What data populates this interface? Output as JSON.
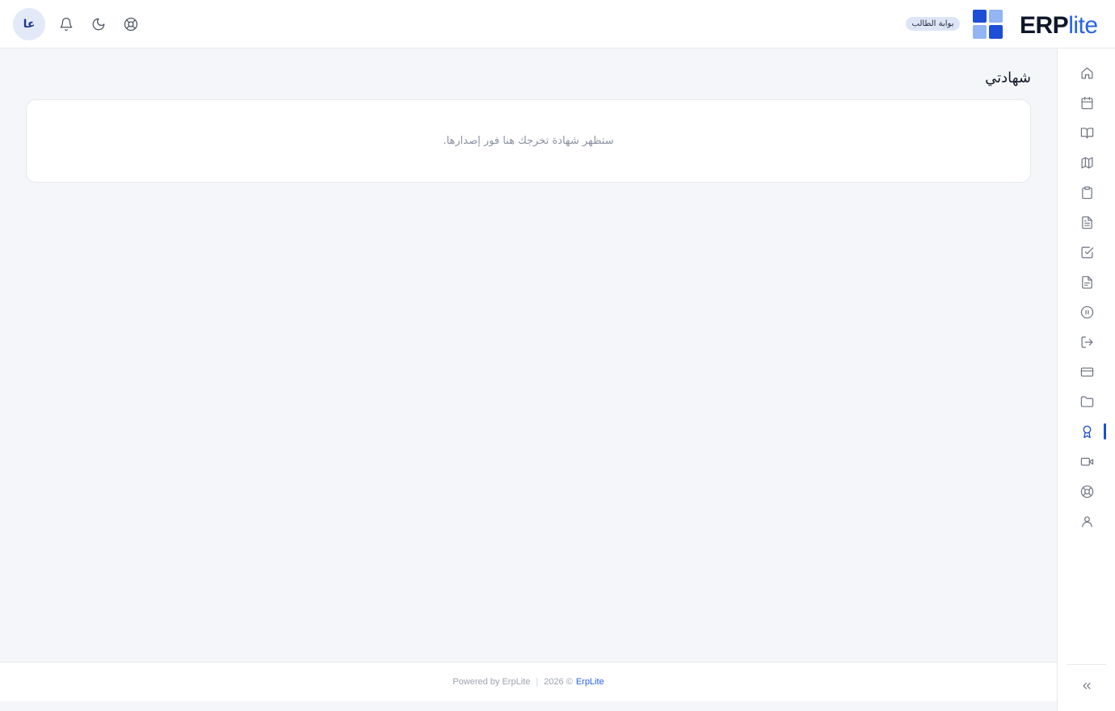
{
  "header": {
    "avatar_initials": "عا",
    "portal_badge": "بوابة الطالب",
    "logo": {
      "part1": "ERP",
      "part2": "lite"
    },
    "icons": [
      "support-icon",
      "moon-icon",
      "bell-icon"
    ]
  },
  "sidebar": {
    "items": [
      {
        "icon": "home-icon"
      },
      {
        "icon": "calendar-icon"
      },
      {
        "icon": "book-open-icon"
      },
      {
        "icon": "map-icon"
      },
      {
        "icon": "clipboard-icon"
      },
      {
        "icon": "file-text-icon"
      },
      {
        "icon": "check-square-icon"
      },
      {
        "icon": "file-lines-icon"
      },
      {
        "icon": "pause-circle-icon"
      },
      {
        "icon": "log-out-icon"
      },
      {
        "icon": "credit-card-icon"
      },
      {
        "icon": "folder-icon"
      },
      {
        "icon": "award-icon",
        "active": true
      },
      {
        "icon": "video-icon"
      },
      {
        "icon": "life-buoy-icon"
      },
      {
        "icon": "user-icon"
      }
    ],
    "collapse_icon": "chevrons-left-icon"
  },
  "main": {
    "page_title": "شهادتي",
    "empty_message": "ستظهر شهادة تخرجك هنا فور إصدارها."
  },
  "footer": {
    "powered": "Powered by ErpLite",
    "copyright": "2026 ©",
    "brand_link": "ErpLite"
  },
  "colors": {
    "accent": "#1d4ed8",
    "background": "#f4f6f9",
    "surface": "#ffffff",
    "border": "#e5e7eb"
  }
}
